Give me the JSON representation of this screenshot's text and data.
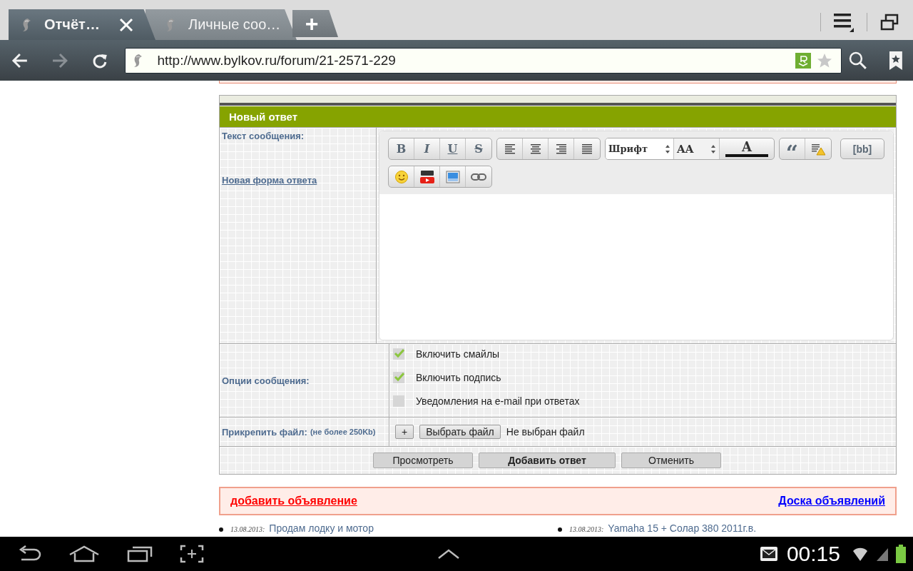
{
  "browser": {
    "tabs": [
      {
        "title": "Отчёт…",
        "selected": true
      },
      {
        "title": "Личные соо…",
        "selected": false
      }
    ],
    "new_tab": "+",
    "nav_buttons": [
      {
        "kind": "back",
        "disabled": false
      },
      {
        "kind": "forward",
        "disabled": true
      },
      {
        "kind": "reload",
        "disabled": false
      }
    ],
    "url": "http://www.bylkov.ru/forum/21-2571-229"
  },
  "form": {
    "title": "Новый ответ",
    "message_label": "Текст сообщения:",
    "new_form_link": "Новая форма ответа",
    "toolbar_rows": [
      [
        {
          "kind": "bold",
          "label": "B"
        },
        {
          "kind": "italic",
          "label": "I"
        },
        {
          "kind": "underline",
          "label": "U"
        },
        {
          "kind": "strike",
          "label": "S"
        },
        {
          "kind": "sep"
        },
        {
          "kind": "align-left"
        },
        {
          "kind": "align-center"
        },
        {
          "kind": "align-right"
        },
        {
          "kind": "align-justify"
        },
        {
          "kind": "sep"
        },
        {
          "kind": "select",
          "label": "Шрифт"
        },
        {
          "kind": "size",
          "label": "AA"
        },
        {
          "kind": "color",
          "label": "A"
        },
        {
          "kind": "sep"
        },
        {
          "kind": "quote",
          "label": "“"
        },
        {
          "kind": "warning"
        },
        {
          "kind": "spacer"
        },
        {
          "kind": "source",
          "label": "[bb]"
        }
      ],
      [
        {
          "kind": "smile"
        },
        {
          "kind": "video"
        },
        {
          "kind": "image"
        },
        {
          "kind": "link"
        }
      ]
    ],
    "options_label": "Опции сообщения:",
    "options": [
      {
        "label": "Включить смайлы",
        "checked": true
      },
      {
        "label": "Включить подпись",
        "checked": true
      },
      {
        "label": "Уведомления на e-mail при ответах",
        "checked": false
      }
    ],
    "attach_label": "Прикрепить файл:",
    "attach_hint": "(не более 250Kb)",
    "add_file": "+",
    "choose_file": "Выбрать файл",
    "file_status": "Не выбран файл",
    "buttons": [
      {
        "label": "Просмотреть",
        "kind": "normal"
      },
      {
        "label": "Добавить ответ",
        "kind": "primary"
      },
      {
        "label": "Отменить",
        "kind": "normal"
      }
    ]
  },
  "ads": {
    "add_link": "добавить объявление",
    "board_link": "Доска объявлений"
  },
  "news": [
    {
      "date": "13.08.2013:",
      "title": "Продам лодку и мотор"
    },
    {
      "date": "13.08.2013:",
      "title": "Yamaha 15 + Солар 380 2011г.в."
    }
  ],
  "status_bar": {
    "time": "00:15"
  }
}
